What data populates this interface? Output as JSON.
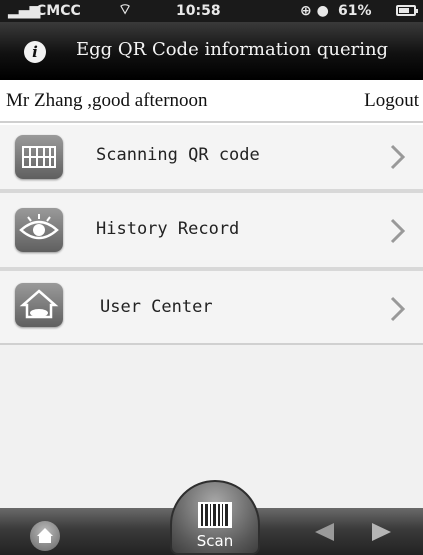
{
  "status_bar": {
    "carrier": "CMCC",
    "time": "10:58",
    "battery": "61%",
    "icons": [
      "signal-icon",
      "wifi-icon",
      "lock-rotation-icon",
      "location-icon",
      "battery-icon"
    ]
  },
  "header": {
    "title": "Egg QR Code information quering",
    "icon": "info-icon"
  },
  "greeting": {
    "text": "Mr Zhang ,good afternoon",
    "logout_label": "Logout"
  },
  "menu": {
    "items": [
      {
        "label": "Scanning QR code",
        "icon": "barcode-scanner-icon"
      },
      {
        "label": "History Record",
        "icon": "eye-icon"
      },
      {
        "label": "User Center",
        "icon": "house-icon"
      }
    ]
  },
  "toolbar": {
    "scan_label": "Scan",
    "icons": [
      "home-icon",
      "barcode-icon",
      "back-arrow-icon",
      "forward-arrow-icon"
    ]
  },
  "colors": {
    "header_bg": "#000000",
    "toolbar_bg": "#3a3a3a",
    "menu_bg": "#f4f4f4"
  }
}
